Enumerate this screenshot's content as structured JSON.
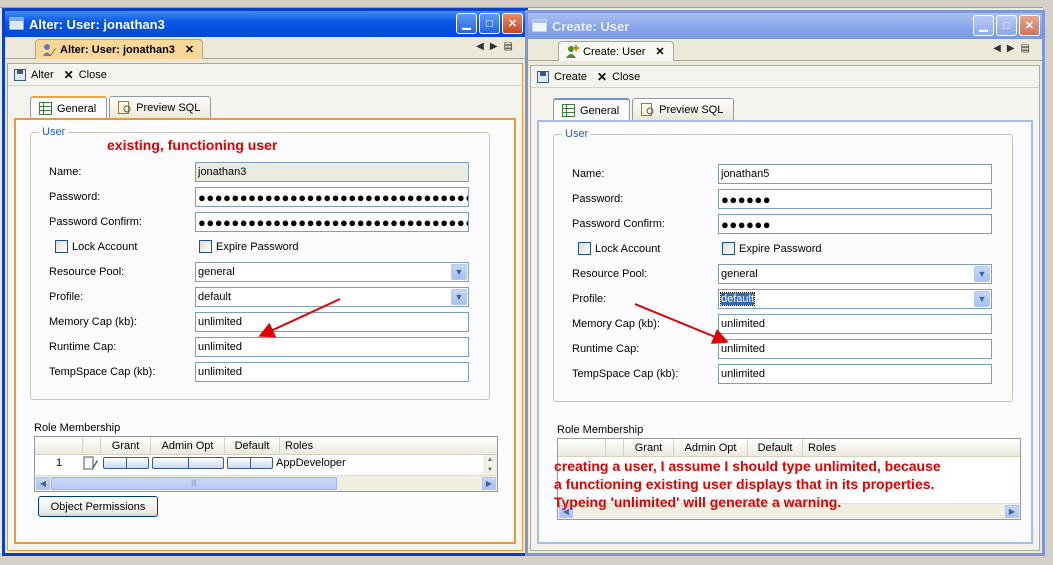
{
  "alter_window": {
    "title": "Alter: User: jonathan3",
    "tab_label": "Alter: User: jonathan3",
    "toolbar": {
      "primary_label": "Alter",
      "close_label": "Close"
    },
    "subtabs": [
      "General",
      "Preview SQL"
    ],
    "group_legend": "User",
    "annotation": "existing, functioning user",
    "fields": {
      "name": {
        "label": "Name:",
        "value": "jonathan3"
      },
      "password": {
        "label": "Password:",
        "value": "●●●●●●●●●●●●●●●●●●●●●●●●●●●●●●●●●●●"
      },
      "password_confirm": {
        "label": "Password Confirm:",
        "value": "●●●●●●●●●●●●●●●●●●●●●●●●●●●●●●●●●●●"
      },
      "lock_account": {
        "label": "Lock Account",
        "checked": false
      },
      "expire_password": {
        "label": "Expire Password",
        "checked": false
      },
      "resource_pool": {
        "label": "Resource Pool:",
        "value": "general"
      },
      "profile": {
        "label": "Profile:",
        "value": "default"
      },
      "memory_cap": {
        "label": "Memory Cap (kb):",
        "value": "unlimited"
      },
      "runtime_cap": {
        "label": "Runtime Cap:",
        "value": "unlimited"
      },
      "tempspace_cap": {
        "label": "TempSpace Cap (kb):",
        "value": "unlimited"
      }
    },
    "role_membership": {
      "label": "Role Membership",
      "columns": [
        "Grant",
        "Admin Opt",
        "Default",
        "Roles"
      ],
      "rows": [
        {
          "num": "1",
          "role": "AppDeveloper"
        }
      ]
    },
    "object_permissions_label": "Object Permissions"
  },
  "create_window": {
    "title": "Create: User",
    "tab_label": "Create: User",
    "toolbar": {
      "primary_label": "Create",
      "close_label": "Close"
    },
    "subtabs": [
      "General",
      "Preview SQL"
    ],
    "group_legend": "User",
    "fields": {
      "name": {
        "label": "Name:",
        "value": "jonathan5"
      },
      "password": {
        "label": "Password:",
        "value": "●●●●●●"
      },
      "password_confirm": {
        "label": "Password Confirm:",
        "value": "●●●●●●"
      },
      "lock_account": {
        "label": "Lock Account",
        "checked": false
      },
      "expire_password": {
        "label": "Expire Password",
        "checked": false
      },
      "resource_pool": {
        "label": "Resource Pool:",
        "value": "general"
      },
      "profile": {
        "label": "Profile:",
        "value": "default"
      },
      "memory_cap": {
        "label": "Memory Cap (kb):",
        "value": "unlimited"
      },
      "runtime_cap": {
        "label": "Runtime Cap:",
        "value": "unlimited"
      },
      "tempspace_cap": {
        "label": "TempSpace Cap (kb):",
        "value": "unlimited"
      }
    },
    "role_membership": {
      "label": "Role Membership",
      "columns": [
        "Grant",
        "Admin Opt",
        "Default",
        "Roles"
      ]
    },
    "annotation_lines": [
      "creating a user, I assume I should type unlimited, because",
      "a functioning existing user displays that in its properties.",
      "Typeing 'unlimited' will generate a warning."
    ]
  },
  "colors": {
    "annotation": "#e00000",
    "active_title": "#0a55e3",
    "inactive_title": "#8aa7ea",
    "legend": "#215dc6"
  }
}
